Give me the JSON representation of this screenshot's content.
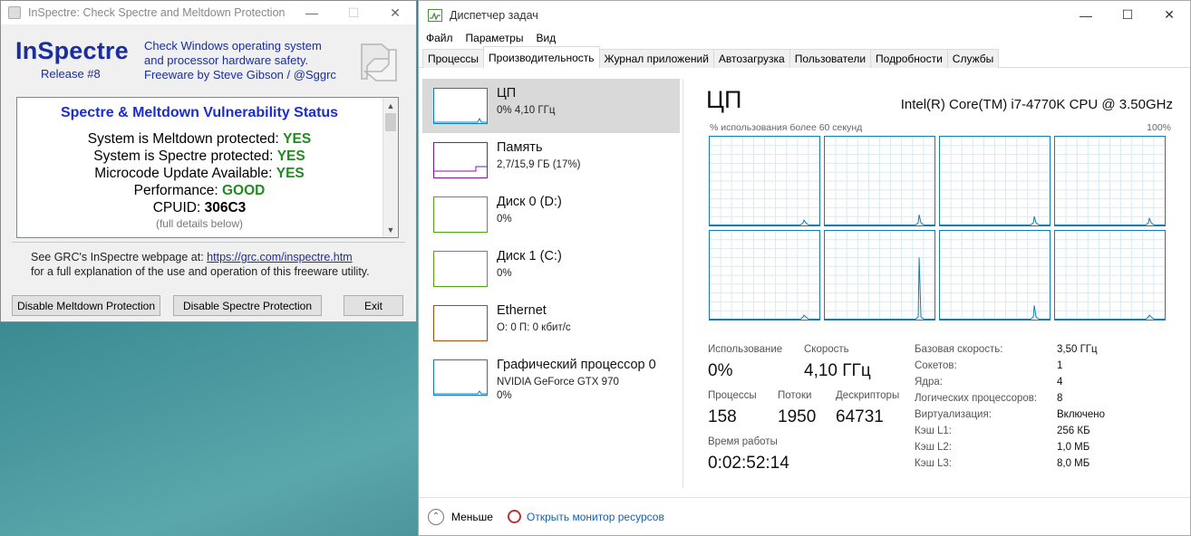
{
  "inspectre": {
    "window_title": "InSpectre: Check Spectre and Meltdown Protection",
    "logo": "InSpectre",
    "release": "Release #8",
    "desc_line1": "Check Windows operating system",
    "desc_line2": "and processor hardware safety.",
    "desc_line3": "Freeware by Steve Gibson / @Sggrc",
    "status_title": "Spectre & Meltdown Vulnerability Status",
    "lines": [
      {
        "label": "System is Meltdown protected:",
        "value": "YES"
      },
      {
        "label": "System is Spectre protected:",
        "value": "YES"
      },
      {
        "label": "Microcode Update Available:",
        "value": "YES"
      },
      {
        "label": "Performance:",
        "value": "GOOD"
      },
      {
        "label": "CPUID:",
        "value": "306C3"
      }
    ],
    "details_hint": "(full details below)",
    "see_prefix": "See GRC's InSpectre webpage at:",
    "see_link": "https://grc.com/inspectre.htm",
    "see_line2": "for a full explanation of the use and operation of this freeware utility.",
    "btn_meltdown": "Disable Meltdown Protection",
    "btn_spectre": "Disable Spectre Protection",
    "btn_exit": "Exit"
  },
  "taskmgr": {
    "window_title": "Диспетчер задач",
    "menu": [
      "Файл",
      "Параметры",
      "Вид"
    ],
    "tabs": [
      "Процессы",
      "Производительность",
      "Журнал приложений",
      "Автозагрузка",
      "Пользователи",
      "Подробности",
      "Службы"
    ],
    "resources": [
      {
        "name": "ЦП",
        "sub": "0% 4,10 ГГц",
        "color": "#117dbb"
      },
      {
        "name": "Память",
        "sub": "2,7/15,9 ГБ (17%)",
        "color": "#8b12ae"
      },
      {
        "name": "Диск 0 (D:)",
        "sub": "0%",
        "color": "#4da60c"
      },
      {
        "name": "Диск 1 (C:)",
        "sub": "0%",
        "color": "#4da60c"
      },
      {
        "name": "Ethernet",
        "sub": "О: 0 П: 0 кбит/с",
        "color": "#a74f01"
      },
      {
        "name": "Графический процессор 0",
        "sub": "NVIDIA GeForce GTX 970",
        "sub2": "0%",
        "color": "#117dbb"
      }
    ],
    "cpu": {
      "title": "ЦП",
      "model": "Intel(R) Core(TM) i7-4770K CPU @ 3.50GHz",
      "graph_label": "% использования более 60 секунд",
      "graph_max": "100%",
      "usage_label": "Использование",
      "usage": "0%",
      "speed_label": "Скорость",
      "speed": "4,10 ГГц",
      "proc_label": "Процессы",
      "proc": "158",
      "threads_label": "Потоки",
      "threads": "1950",
      "handles_label": "Дескрипторы",
      "handles": "64731",
      "uptime_label": "Время работы",
      "uptime": "0:02:52:14",
      "details": [
        {
          "k": "Базовая скорость:",
          "v": "3,50 ГГц"
        },
        {
          "k": "Сокетов:",
          "v": "1"
        },
        {
          "k": "Ядра:",
          "v": "4"
        },
        {
          "k": "Логических процессоров:",
          "v": "8"
        },
        {
          "k": "Виртуализация:",
          "v": "Включено"
        },
        {
          "k": "Кэш L1:",
          "v": "256 КБ"
        },
        {
          "k": "Кэш L2:",
          "v": "1,0 МБ"
        },
        {
          "k": "Кэш L3:",
          "v": "8,0 МБ"
        }
      ]
    },
    "fewer": "Меньше",
    "resmon": "Открыть монитор ресурсов"
  }
}
